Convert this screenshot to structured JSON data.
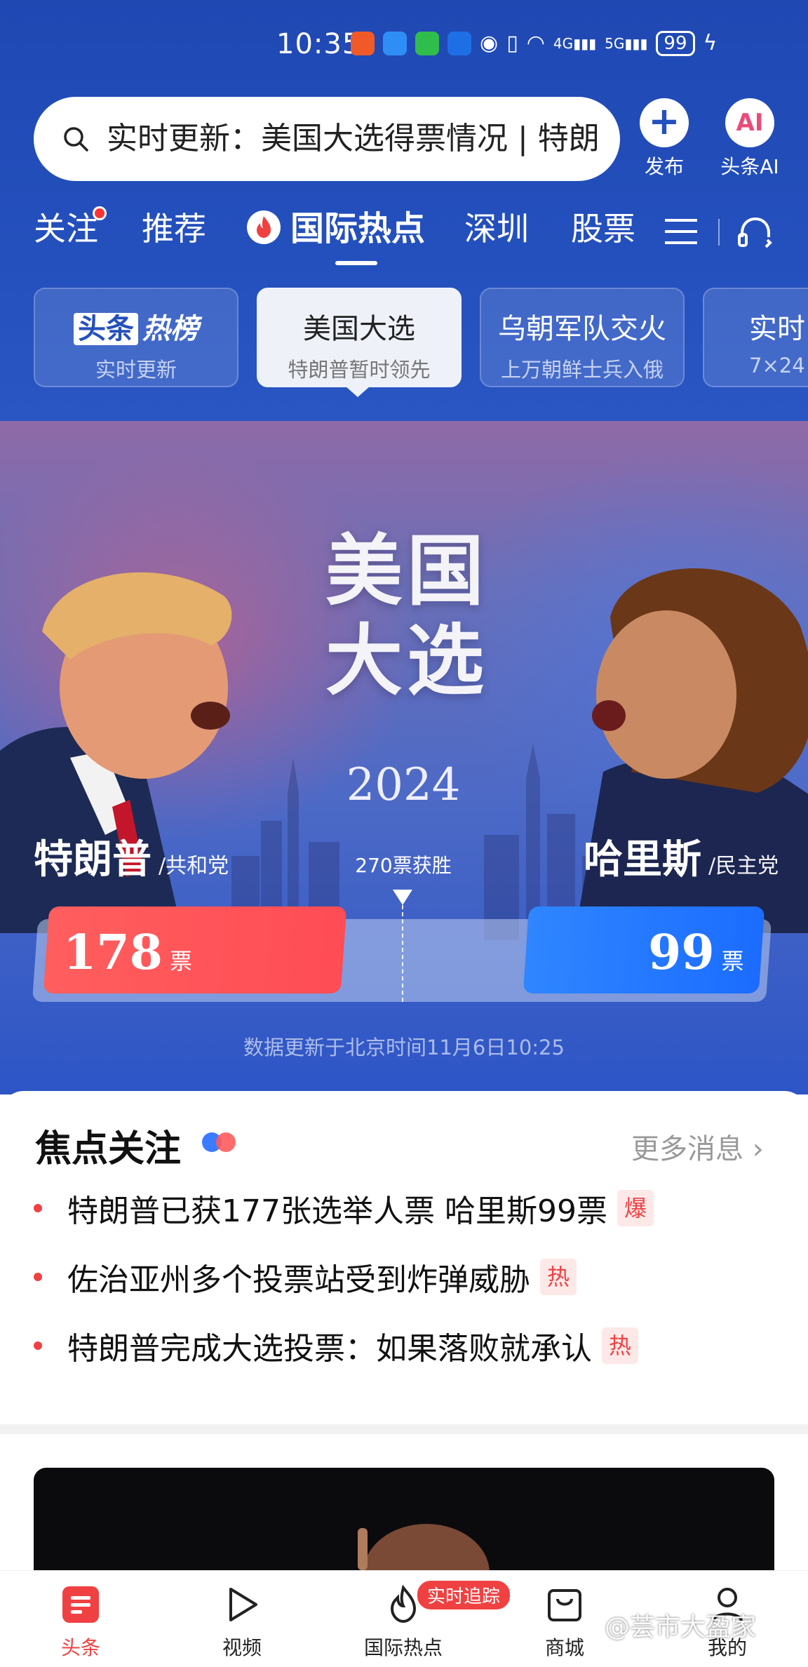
{
  "status_bar": {
    "time": "10:35",
    "battery": "99",
    "net_4g": "4G",
    "net_5g": "5G"
  },
  "search": {
    "text": "实时更新：美国大选得票情况 | 特朗"
  },
  "top_actions": {
    "publish_label": "发布",
    "ai_icon_text": "AI",
    "ai_label": "头条AI"
  },
  "channel_tabs": [
    {
      "label": "关注"
    },
    {
      "label": "推荐"
    },
    {
      "label": "国际热点"
    },
    {
      "label": "深圳"
    },
    {
      "label": "股票"
    }
  ],
  "topics": [
    {
      "logo_a": "头条",
      "logo_b": "热榜",
      "sub": "实时更新"
    },
    {
      "title": "美国大选",
      "sub": "特朗普暂时领先"
    },
    {
      "title": "乌朝军队交火",
      "sub": "上万朝鲜士兵入俄"
    },
    {
      "title": "实时",
      "sub": "7×24"
    }
  ],
  "banner": {
    "title_line1": "美国",
    "title_line2": "大选",
    "year": "2024",
    "left_name": "特朗普",
    "left_party": "/共和党",
    "right_name": "哈里斯",
    "right_party": "/民主党",
    "win_label": "270票获胜",
    "left_votes": "178",
    "right_votes": "99",
    "vote_unit": "票",
    "update_note": "数据更新于北京时间11月6日10:25"
  },
  "chart_data": {
    "type": "bar",
    "categories": [
      "特朗普",
      "哈里斯"
    ],
    "values": [
      178,
      99
    ],
    "target": 270
  },
  "focus": {
    "title": "焦点关注",
    "more": "更多消息 ›",
    "items": [
      {
        "text": "特朗普已获177张选举人票 哈里斯99票",
        "badge": "爆"
      },
      {
        "text": "佐治亚州多个投票站受到炸弹威胁",
        "badge": "热"
      },
      {
        "text": "特朗普完成大选投票：如果落败就承认",
        "badge": "热"
      }
    ]
  },
  "bottom_nav": {
    "items": [
      {
        "label": "头条"
      },
      {
        "label": "视频"
      },
      {
        "label": "国际热点"
      },
      {
        "label": "商城"
      },
      {
        "label": "我的"
      }
    ],
    "badge": "实时追踪"
  },
  "watermark": "@芸市大盈家",
  "colors": {
    "brand_red": "#f04142",
    "header_blue": "#2450bd",
    "republican_red": "#ff4c55",
    "democrat_blue": "#1b6cff"
  }
}
